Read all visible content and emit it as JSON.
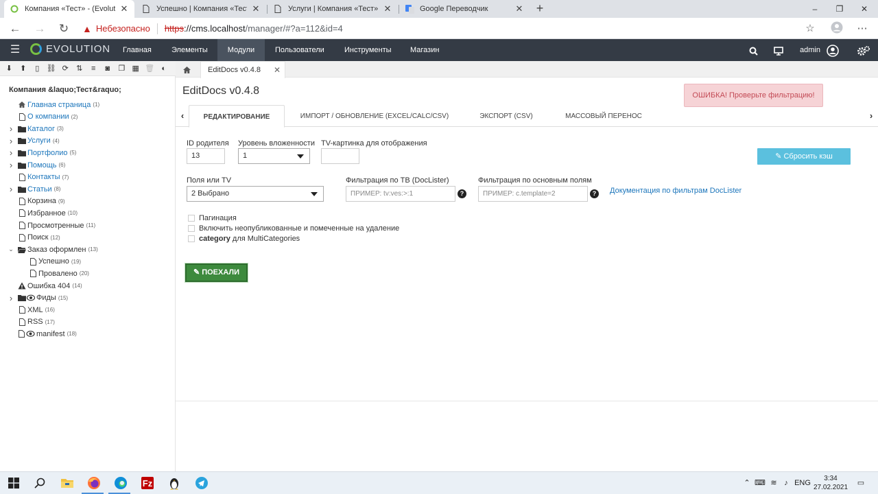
{
  "browser": {
    "tabs": [
      {
        "title": "Компания «Тест» - (Evolution CI",
        "active": true
      },
      {
        "title": "Успешно | Компания «Тест»",
        "active": false
      },
      {
        "title": "Услуги | Компания «Тест»",
        "active": false
      },
      {
        "title": "Google Переводчик",
        "active": false
      }
    ],
    "tab_close": "✕",
    "new_tab": "+",
    "window_controls": [
      "–",
      "❐",
      "✕"
    ],
    "security_warning": "Небезопасно",
    "url_scheme": "https",
    "url_host": "://cms.localhost",
    "url_rest": "/manager/#?a=112&id=4"
  },
  "evo": {
    "logo_text": "EVOLUTION",
    "menu": [
      {
        "label": "Главная",
        "active": false
      },
      {
        "label": "Элементы",
        "active": false
      },
      {
        "label": "Модули",
        "active": true
      },
      {
        "label": "Пользователи",
        "active": false
      },
      {
        "label": "Инструменты",
        "active": false
      },
      {
        "label": "Магазин",
        "active": false
      }
    ],
    "user": "admin"
  },
  "tree": {
    "root": "Компания &laquo;Тест&raquo;",
    "nodes": [
      {
        "label": "Главная страница",
        "count": "(1)",
        "icon": "home-icon",
        "link": true,
        "expand": "",
        "depth": 0
      },
      {
        "label": "О компании",
        "count": "(2)",
        "icon": "page-icon",
        "link": true,
        "expand": "",
        "depth": 0
      },
      {
        "label": "Каталог",
        "count": "(3)",
        "icon": "folder-icon",
        "link": true,
        "expand": "right",
        "depth": 0
      },
      {
        "label": "Услуги",
        "count": "(4)",
        "icon": "folder-icon",
        "link": true,
        "expand": "right",
        "depth": 0
      },
      {
        "label": "Портфолио",
        "count": "(5)",
        "icon": "folder-icon",
        "link": true,
        "expand": "right",
        "depth": 0
      },
      {
        "label": "Помощь",
        "count": "(6)",
        "icon": "folder-icon",
        "link": true,
        "expand": "right",
        "depth": 0
      },
      {
        "label": "Контакты",
        "count": "(7)",
        "icon": "page-icon",
        "link": true,
        "expand": "",
        "depth": 0
      },
      {
        "label": "Статьи",
        "count": "(8)",
        "icon": "folder-icon",
        "link": true,
        "expand": "right",
        "depth": 0
      },
      {
        "label": "Корзина",
        "count": "(9)",
        "icon": "page-icon",
        "link": false,
        "expand": "",
        "depth": 0
      },
      {
        "label": "Избранное",
        "count": "(10)",
        "icon": "page-icon",
        "link": false,
        "expand": "",
        "depth": 0
      },
      {
        "label": "Просмотренные",
        "count": "(11)",
        "icon": "page-icon",
        "link": false,
        "expand": "",
        "depth": 0
      },
      {
        "label": "Поиск",
        "count": "(12)",
        "icon": "page-icon",
        "link": false,
        "expand": "",
        "depth": 0
      },
      {
        "label": "Заказ оформлен",
        "count": "(13)",
        "icon": "folder-open-icon",
        "link": false,
        "expand": "down",
        "depth": 0
      },
      {
        "label": "Успешно",
        "count": "(19)",
        "icon": "page-icon",
        "link": false,
        "expand": "",
        "depth": 1
      },
      {
        "label": "Провалено",
        "count": "(20)",
        "icon": "page-icon",
        "link": false,
        "expand": "",
        "depth": 1
      },
      {
        "label": "Ошибка 404",
        "count": "(14)",
        "icon": "warning-icon",
        "link": false,
        "expand": "",
        "depth": 0
      },
      {
        "label": "Фиды",
        "count": "(15)",
        "icon": "folder-eye-icon",
        "link": false,
        "expand": "right",
        "depth": 0
      },
      {
        "label": "XML",
        "count": "(16)",
        "icon": "page-icon",
        "link": false,
        "expand": "",
        "depth": 0
      },
      {
        "label": "RSS",
        "count": "(17)",
        "icon": "page-icon",
        "link": false,
        "expand": "",
        "depth": 0
      },
      {
        "label": "manifest",
        "count": "(18)",
        "icon": "page-eye-icon",
        "link": false,
        "expand": "",
        "depth": 0
      }
    ]
  },
  "main": {
    "home_tab_icon": "home-icon",
    "doc_tab": "EditDocs v0.4.8",
    "title": "EditDocs v0.4.8",
    "error": "ОШИБКА! Проверьте фильтрацию!",
    "subtabs": [
      {
        "label": "Редактирование",
        "active": true
      },
      {
        "label": "Импорт / Обновление (Excel/Calc/CSV)",
        "active": false
      },
      {
        "label": "Экспорт (CSV)",
        "active": false
      },
      {
        "label": "Массовый перенос",
        "active": false
      }
    ],
    "form": {
      "parent_id_label": "ID родителя",
      "parent_id_value": "13",
      "depth_label": "Уровень вложенности",
      "depth_value": "1",
      "tv_image_label": "TV-картинка для отображения",
      "tv_image_value": "",
      "clear_cache": "Сбросить кэш",
      "fields_label": "Поля или TV",
      "fields_value": "2 Выбрано",
      "filter_tv_label": "Фильтрация по ТВ (DocLister)",
      "filter_tv_placeholder": "ПРИМЕР: tv:ves:>:1",
      "filter_main_label": "Фильтрация по основным полям",
      "filter_main_placeholder": "ПРИМЕР: c.template=2",
      "doc_link": "Документация по фильтрам DocLister",
      "pagination": "Пагинация",
      "include_unpublished": "Включить неопубликованные и помеченные на удаление",
      "category_bold": "category",
      "category_rest": " для MultiCategories",
      "go_button": "ПОЕХАЛИ"
    }
  },
  "taskbar": {
    "lang": "ENG",
    "time": "3:34",
    "date": "27.02.2021"
  },
  "colors": {
    "evo_bar": "#343b45",
    "error_bg": "#f6d3d6",
    "clear_cache_btn": "#5bc0de",
    "go_btn": "#3d8a3d",
    "link": "#1b75bb"
  }
}
